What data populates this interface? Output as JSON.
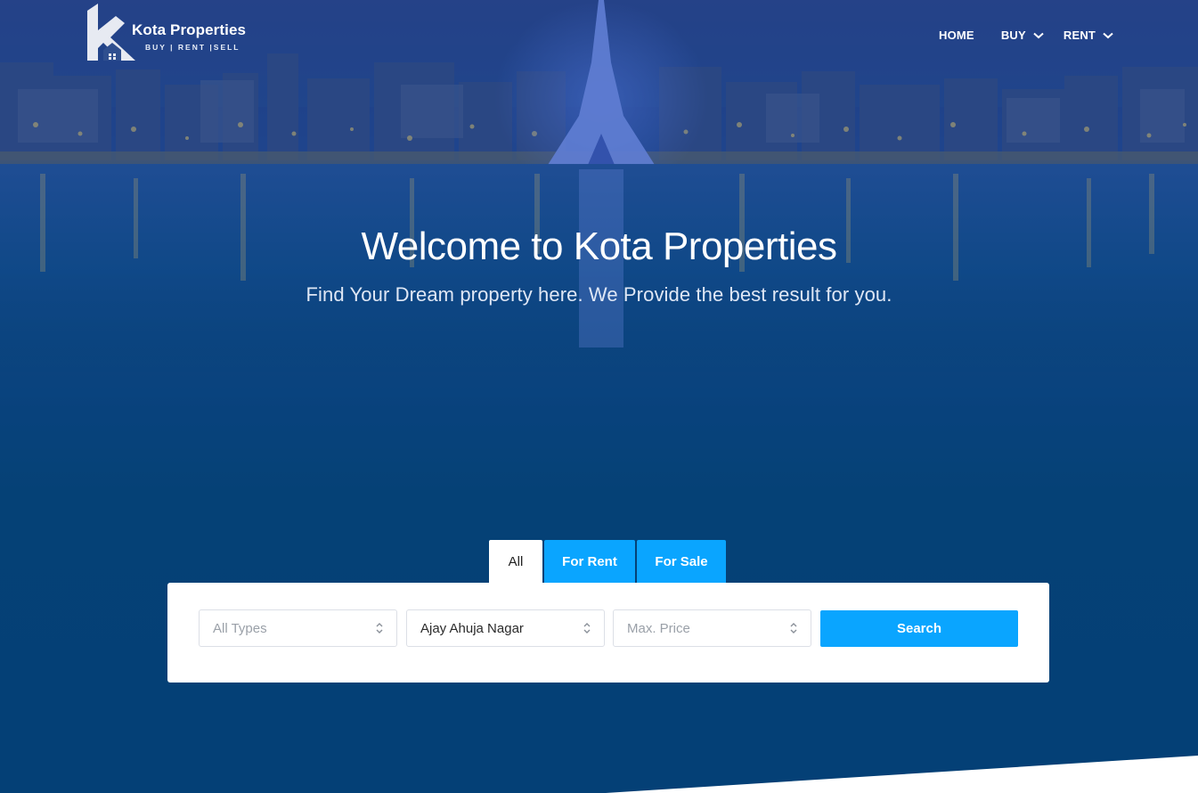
{
  "brand": {
    "name": "Kota Properties",
    "tagline": "BUY | RENT |SELL"
  },
  "nav": {
    "items": [
      {
        "label": "HOME",
        "has_dropdown": false
      },
      {
        "label": "BUY",
        "has_dropdown": true
      },
      {
        "label": "RENT",
        "has_dropdown": true
      }
    ]
  },
  "hero": {
    "title": "Welcome to Kota Properties",
    "subtitle": "Find Your Dream property here. We Provide the best result for you."
  },
  "search": {
    "tabs": [
      {
        "label": "All",
        "active": true
      },
      {
        "label": "For Rent",
        "active": false
      },
      {
        "label": "For Sale",
        "active": false
      }
    ],
    "type_select": {
      "value": "All Types",
      "is_placeholder": true
    },
    "location_select": {
      "value": "Ajay Ahuja Nagar",
      "is_placeholder": false
    },
    "price_select": {
      "value": "Max. Price",
      "is_placeholder": true
    },
    "button_label": "Search"
  },
  "colors": {
    "accent": "#0aa5ff",
    "hero_bottom": "#00436f",
    "panel": "#ffffff"
  }
}
